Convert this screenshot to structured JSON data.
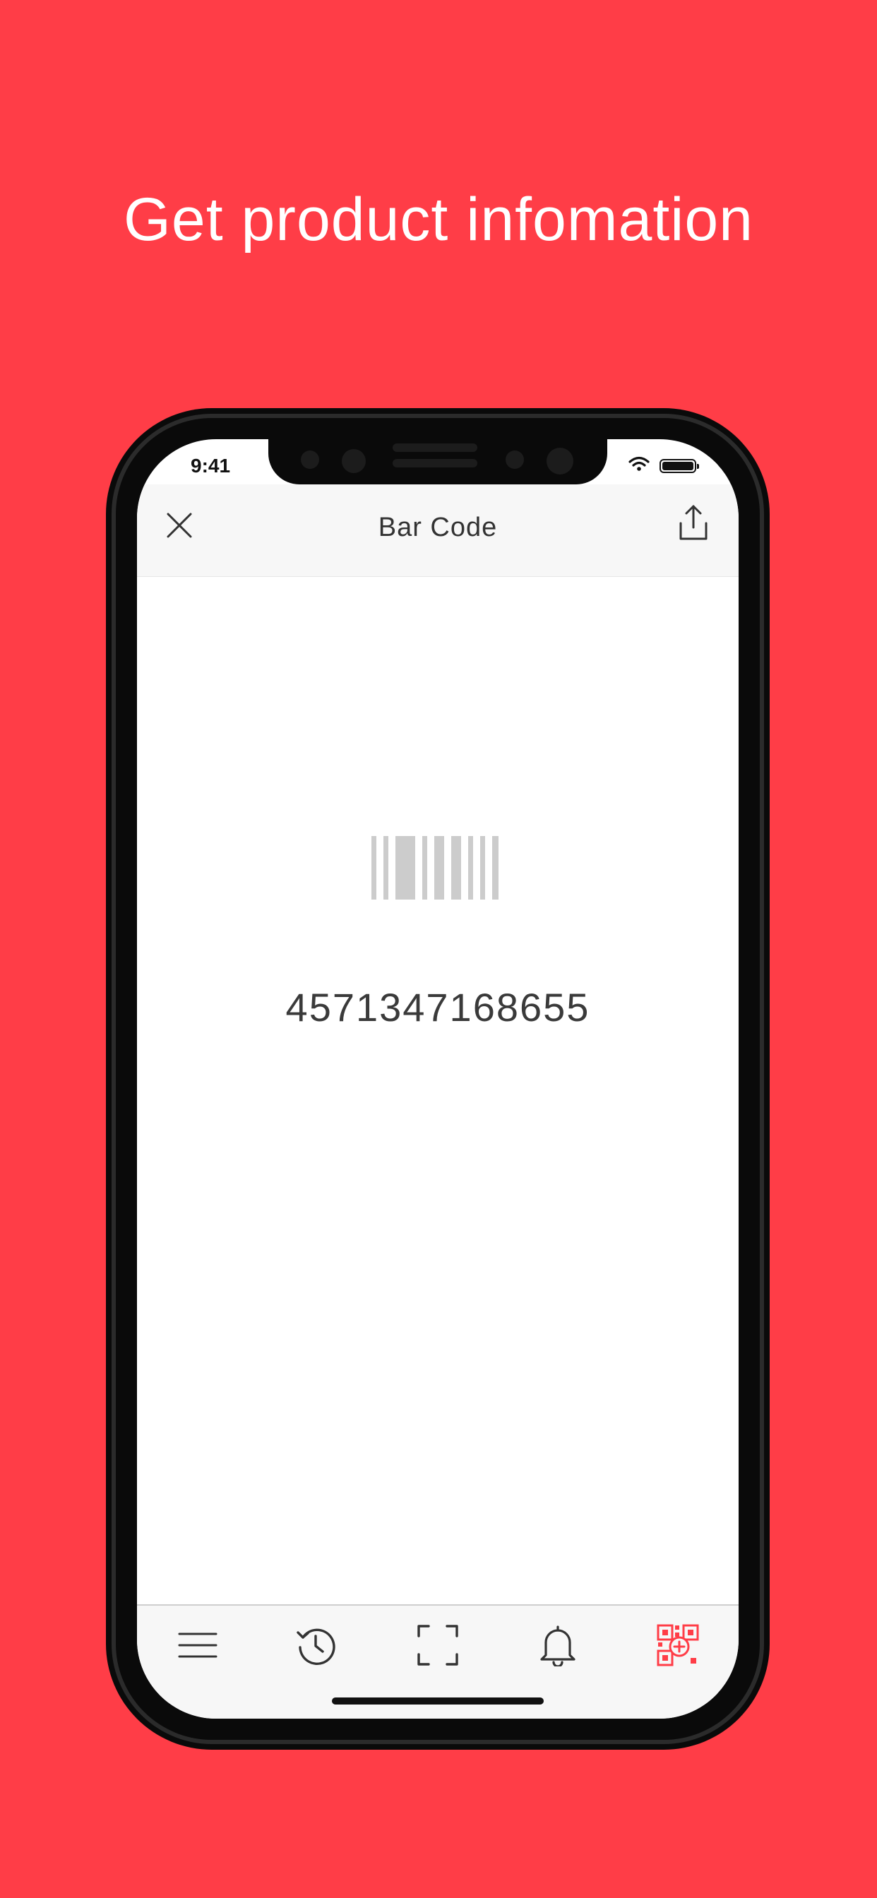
{
  "headline": "Get product infomation",
  "status_bar": {
    "time": "9:41",
    "icons": [
      "wifi-icon",
      "battery-icon"
    ]
  },
  "nav": {
    "title": "Bar Code",
    "left_icon": "close-icon",
    "right_icon": "share-icon"
  },
  "content": {
    "barcode_icon": "barcode-icon",
    "barcode_number": "4571347168655"
  },
  "tab_bar": {
    "items": [
      {
        "icon": "menu-icon",
        "active": false
      },
      {
        "icon": "history-icon",
        "active": false
      },
      {
        "icon": "scan-frame-icon",
        "active": false
      },
      {
        "icon": "bell-icon",
        "active": false
      },
      {
        "icon": "qr-code-add-icon",
        "active": true
      }
    ]
  },
  "colors": {
    "background": "#FF3D47",
    "accent": "#FF3D47",
    "text_primary": "#333333",
    "icon": "#333333"
  }
}
